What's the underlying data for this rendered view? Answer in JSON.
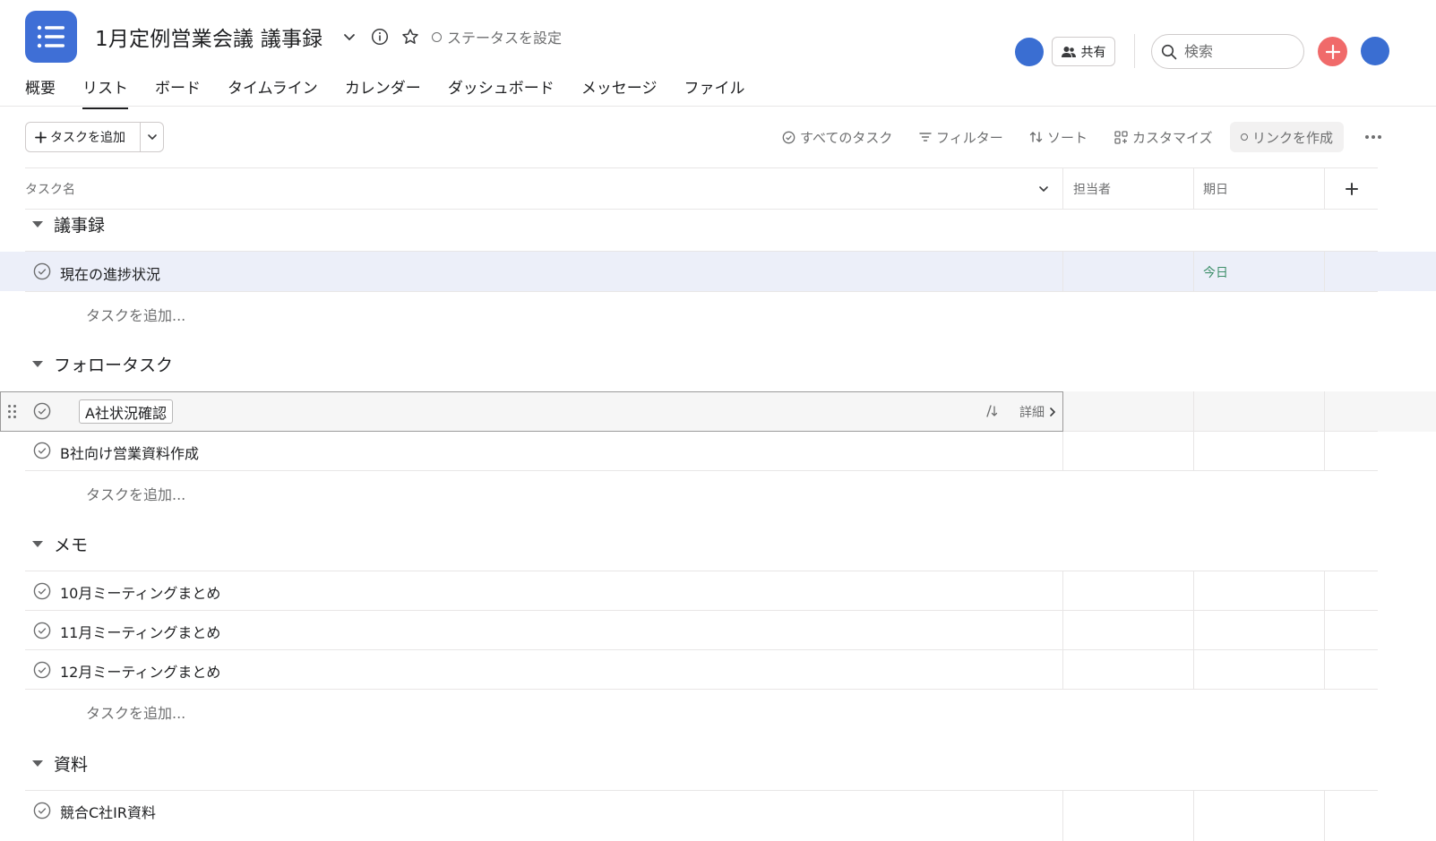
{
  "project": {
    "title": "1月定例営業会議 議事録",
    "status_label": "ステータスを設定",
    "share_label": "共有"
  },
  "search": {
    "placeholder": "検索"
  },
  "tabs": [
    {
      "label": "概要",
      "active": false
    },
    {
      "label": "リスト",
      "active": true
    },
    {
      "label": "ボード",
      "active": false
    },
    {
      "label": "タイムライン",
      "active": false
    },
    {
      "label": "カレンダー",
      "active": false
    },
    {
      "label": "ダッシュボード",
      "active": false
    },
    {
      "label": "メッセージ",
      "active": false
    },
    {
      "label": "ファイル",
      "active": false
    }
  ],
  "toolbar": {
    "add_task": "タスクを追加",
    "all_tasks": "すべてのタスク",
    "filter": "フィルター",
    "sort": "ソート",
    "customize": "カスタマイズ",
    "create_link": "リンクを作成"
  },
  "columns": {
    "task_name": "タスク名",
    "assignee": "担当者",
    "due": "期日"
  },
  "sections": [
    {
      "name": "議事録",
      "tasks": [
        {
          "name": "現在の進捗状況",
          "due": "今日"
        }
      ]
    },
    {
      "name": "フォロータスク",
      "tasks": [
        {
          "name": "A社状況確認",
          "due": ""
        },
        {
          "name": "B社向け営業資料作成",
          "due": ""
        }
      ]
    },
    {
      "name": "メモ",
      "tasks": [
        {
          "name": "10月ミーティングまとめ",
          "due": ""
        },
        {
          "name": "11月ミーティングまとめ",
          "due": ""
        },
        {
          "name": "12月ミーティングまとめ",
          "due": ""
        }
      ]
    },
    {
      "name": "資料",
      "tasks": [
        {
          "name": "競合C社IR資料",
          "due": ""
        }
      ]
    }
  ],
  "add_task_inline": "タスクを追加...",
  "details_label": "詳細",
  "colors": {
    "accent": "#3f6fd6",
    "add_button": "#f06a6a",
    "today": "#3d8f6a",
    "highlight": "#eceff9"
  }
}
